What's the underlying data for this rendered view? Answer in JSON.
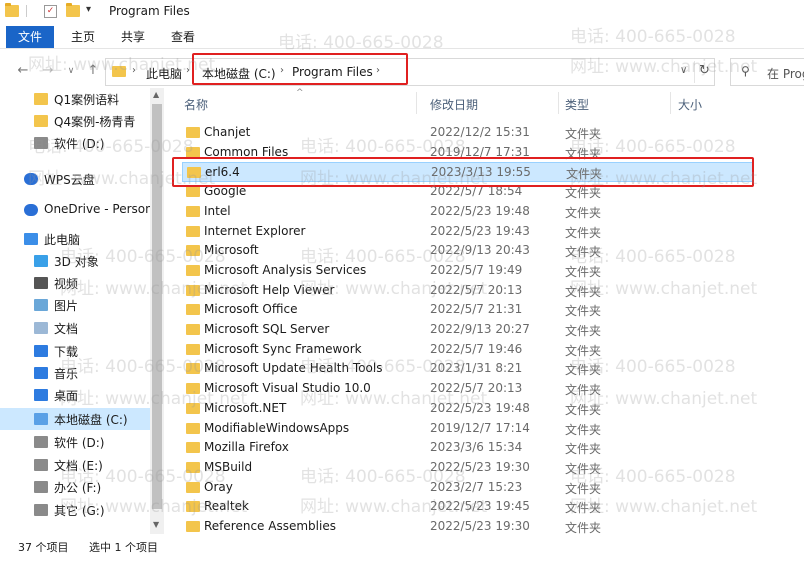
{
  "window": {
    "title": "Program Files"
  },
  "ribbon": {
    "tabs": [
      "文件",
      "主页",
      "共享",
      "查看"
    ]
  },
  "address": {
    "crumbs": [
      "此电脑",
      "本地磁盘 (C:)",
      "Program Files"
    ],
    "search_placeholder": "在 Prog"
  },
  "nav": {
    "items": [
      {
        "label": "Q1案例语料",
        "icon": "folder-icon"
      },
      {
        "label": "Q4案例-杨青青",
        "icon": "folder-icon"
      },
      {
        "label": "软件 (D:)",
        "icon": "drive-icon"
      },
      {
        "label": "WPS云盘",
        "icon": "cloud-icon"
      },
      {
        "label": "OneDrive - Person",
        "icon": "cloud-icon"
      },
      {
        "label": "此电脑",
        "icon": "computer-icon"
      },
      {
        "label": "3D 对象",
        "icon": "cube-icon"
      },
      {
        "label": "视频",
        "icon": "video-icon"
      },
      {
        "label": "图片",
        "icon": "picture-icon"
      },
      {
        "label": "文档",
        "icon": "document-icon"
      },
      {
        "label": "下载",
        "icon": "download-icon"
      },
      {
        "label": "音乐",
        "icon": "music-icon"
      },
      {
        "label": "桌面",
        "icon": "desktop-icon"
      },
      {
        "label": "本地磁盘 (C:)",
        "icon": "windows-drive-icon"
      },
      {
        "label": "软件 (D:)",
        "icon": "drive-icon"
      },
      {
        "label": "文档 (E:)",
        "icon": "drive-icon"
      },
      {
        "label": "办公 (F:)",
        "icon": "drive-icon"
      },
      {
        "label": "其它 (G:)",
        "icon": "drive-icon"
      }
    ]
  },
  "list": {
    "headers": {
      "name": "名称",
      "date": "修改日期",
      "type": "类型",
      "size": "大小"
    },
    "rows": [
      {
        "name": "Chanjet",
        "date": "2022/12/2 15:31",
        "type": "文件夹"
      },
      {
        "name": "Common Files",
        "date": "2019/12/7 17:31",
        "type": "文件夹"
      },
      {
        "name": "erl6.4",
        "date": "2023/3/13 19:55",
        "type": "文件夹"
      },
      {
        "name": "Google",
        "date": "2022/5/7 18:54",
        "type": "文件夹"
      },
      {
        "name": "Intel",
        "date": "2022/5/23 19:48",
        "type": "文件夹"
      },
      {
        "name": "Internet Explorer",
        "date": "2022/5/23 19:43",
        "type": "文件夹"
      },
      {
        "name": "Microsoft",
        "date": "2022/9/13 20:43",
        "type": "文件夹"
      },
      {
        "name": "Microsoft Analysis Services",
        "date": "2022/5/7 19:49",
        "type": "文件夹"
      },
      {
        "name": "Microsoft Help Viewer",
        "date": "2022/5/7 20:13",
        "type": "文件夹"
      },
      {
        "name": "Microsoft Office",
        "date": "2022/5/7 21:31",
        "type": "文件夹"
      },
      {
        "name": "Microsoft SQL Server",
        "date": "2022/9/13 20:27",
        "type": "文件夹"
      },
      {
        "name": "Microsoft Sync Framework",
        "date": "2022/5/7 19:46",
        "type": "文件夹"
      },
      {
        "name": "Microsoft Update Health Tools",
        "date": "2023/1/31 8:21",
        "type": "文件夹"
      },
      {
        "name": "Microsoft Visual Studio 10.0",
        "date": "2022/5/7 20:13",
        "type": "文件夹"
      },
      {
        "name": "Microsoft.NET",
        "date": "2022/5/23 19:48",
        "type": "文件夹"
      },
      {
        "name": "ModifiableWindowsApps",
        "date": "2019/12/7 17:14",
        "type": "文件夹"
      },
      {
        "name": "Mozilla Firefox",
        "date": "2023/3/6 15:34",
        "type": "文件夹"
      },
      {
        "name": "MSBuild",
        "date": "2022/5/23 19:30",
        "type": "文件夹"
      },
      {
        "name": "Oray",
        "date": "2023/2/7 15:23",
        "type": "文件夹"
      },
      {
        "name": "Realtek",
        "date": "2022/5/23 19:45",
        "type": "文件夹"
      },
      {
        "name": "Reference Assemblies",
        "date": "2022/5/23 19:30",
        "type": "文件夹"
      }
    ],
    "selected_index": 2
  },
  "status": {
    "count": "37 个项目",
    "selected": "选中 1 个项目"
  },
  "watermarks": {
    "phone": "电话: 400-665-0028",
    "site": "网址: www.chanjet.net"
  },
  "colors": {
    "accent": "#1a65c8",
    "highlight": "#e02020",
    "selection": "#cce8ff",
    "folder": "#f3c54c"
  }
}
